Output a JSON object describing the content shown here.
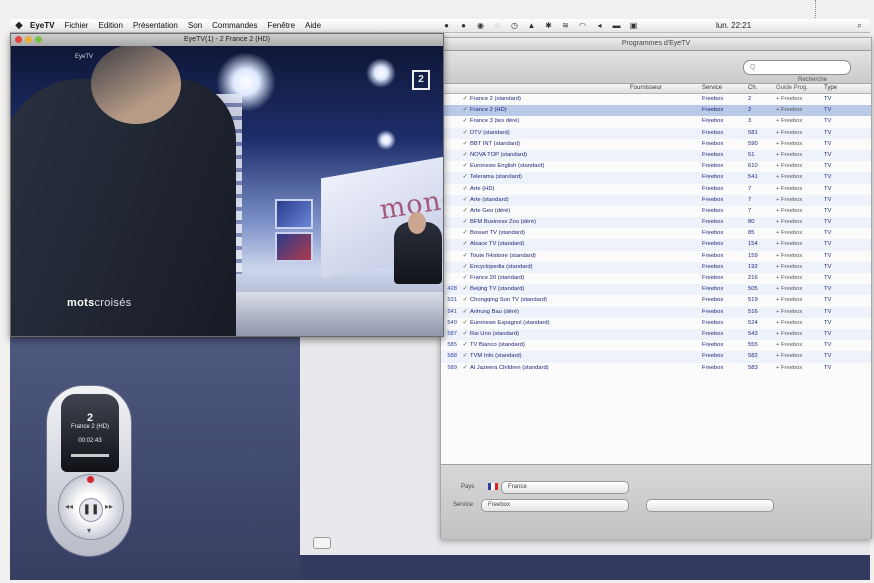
{
  "menubar": {
    "app_name": "EyeTV",
    "menus": [
      "Fichier",
      "Edition",
      "Présentation",
      "Son",
      "Commandes",
      "Fenêtre",
      "Aide"
    ],
    "clock": "lun. 22:21"
  },
  "video_window": {
    "title": "EyeTV(1) - 2 France 2 (HD)",
    "logo_text": "mots",
    "logo_text2": "croisés",
    "banner_text": "mondialis",
    "small_logo": "EyeTV",
    "channel_badge": "2"
  },
  "remote": {
    "channel_number": "2",
    "channel_name": "France 2 (HD)",
    "time": "00:02:43",
    "play_symbol": "❚❚"
  },
  "programs_window": {
    "title": "Programmes d'EyeTV",
    "search_placeholder": "Q",
    "toolbar_label": "Recherche",
    "columns": [
      "",
      "",
      "",
      "Fournisseur",
      "Service",
      "Ch.",
      "Guide Prog.",
      "Type"
    ],
    "rows": [
      {
        "num": "",
        "name": "France 2 (standard)",
        "service": "Freebox",
        "ch": "2",
        "type": "TV"
      },
      {
        "num": "",
        "name": "France 2 (HD)",
        "service": "Freebox",
        "ch": "2",
        "type": "TV",
        "selected": true
      },
      {
        "num": "",
        "name": "France 3 (tes déré)",
        "service": "Freebox",
        "ch": "3",
        "type": "TV"
      },
      {
        "num": "",
        "name": "DTV (standard)",
        "service": "Freebox",
        "ch": "581",
        "type": "TV"
      },
      {
        "num": "",
        "name": "BBT INT (standard)",
        "service": "Freebox",
        "ch": "590",
        "type": "TV"
      },
      {
        "num": "",
        "name": "NOVA TOP (standard)",
        "service": "Freebox",
        "ch": "51",
        "type": "TV"
      },
      {
        "num": "",
        "name": "Euronews English (standard)",
        "service": "Freebox",
        "ch": "610",
        "type": "TV"
      },
      {
        "num": "",
        "name": "Telerama (standard)",
        "service": "Freebox",
        "ch": "541",
        "type": "TV"
      },
      {
        "num": "",
        "name": "Arte (HD)",
        "service": "Freebox",
        "ch": "7",
        "type": "TV"
      },
      {
        "num": "",
        "name": "Arte (standard)",
        "service": "Freebox",
        "ch": "7",
        "type": "TV"
      },
      {
        "num": "",
        "name": "Arte Geo (déré)",
        "service": "Freebox",
        "ch": "7",
        "type": "TV"
      },
      {
        "num": "",
        "name": "BFM Business Zoo (déré)",
        "service": "Freebox",
        "ch": "80",
        "type": "TV"
      },
      {
        "num": "",
        "name": "Bosuet TV (standard)",
        "service": "Freebox",
        "ch": "85",
        "type": "TV"
      },
      {
        "num": "",
        "name": "Alsace TV (standard)",
        "service": "Freebox",
        "ch": "154",
        "type": "TV"
      },
      {
        "num": "",
        "name": "Toute l'Histoire (standard)",
        "service": "Freebox",
        "ch": "159",
        "type": "TV"
      },
      {
        "num": "",
        "name": "Encyclopedia (standard)",
        "service": "Freebox",
        "ch": "192",
        "type": "TV"
      },
      {
        "num": "",
        "name": "France 20 (standard)",
        "service": "Freebox",
        "ch": "216",
        "type": "TV"
      },
      {
        "num": "428",
        "name": "Beijing TV (standard)",
        "service": "Freebox",
        "ch": "505",
        "type": "TV"
      },
      {
        "num": "531",
        "name": "Chongqing Sun TV (standard)",
        "service": "Freebox",
        "ch": "519",
        "type": "TV"
      },
      {
        "num": "541",
        "name": "Anhung Bau (déré)",
        "service": "Freebox",
        "ch": "516",
        "type": "TV"
      },
      {
        "num": "549",
        "name": "Euronews Espagnol (standard)",
        "service": "Freebox",
        "ch": "524",
        "type": "TV"
      },
      {
        "num": "587",
        "name": "Rai Uno (standard)",
        "service": "Freebox",
        "ch": "543",
        "type": "TV"
      },
      {
        "num": "585",
        "name": "TV Bianco (standard)",
        "service": "Freebox",
        "ch": "555",
        "type": "TV"
      },
      {
        "num": "588",
        "name": "TVM Info (standard)",
        "service": "Freebox",
        "ch": "582",
        "type": "TV"
      },
      {
        "num": "589",
        "name": "Al Jazeera Children (standard)",
        "service": "Freebox",
        "ch": "583",
        "type": "TV"
      }
    ],
    "guide_value": "+ Freebox",
    "bottom_label1": "Pays",
    "bottom_value1": "France",
    "bottom_label2": "Service",
    "bottom_value2": "Freebox"
  }
}
